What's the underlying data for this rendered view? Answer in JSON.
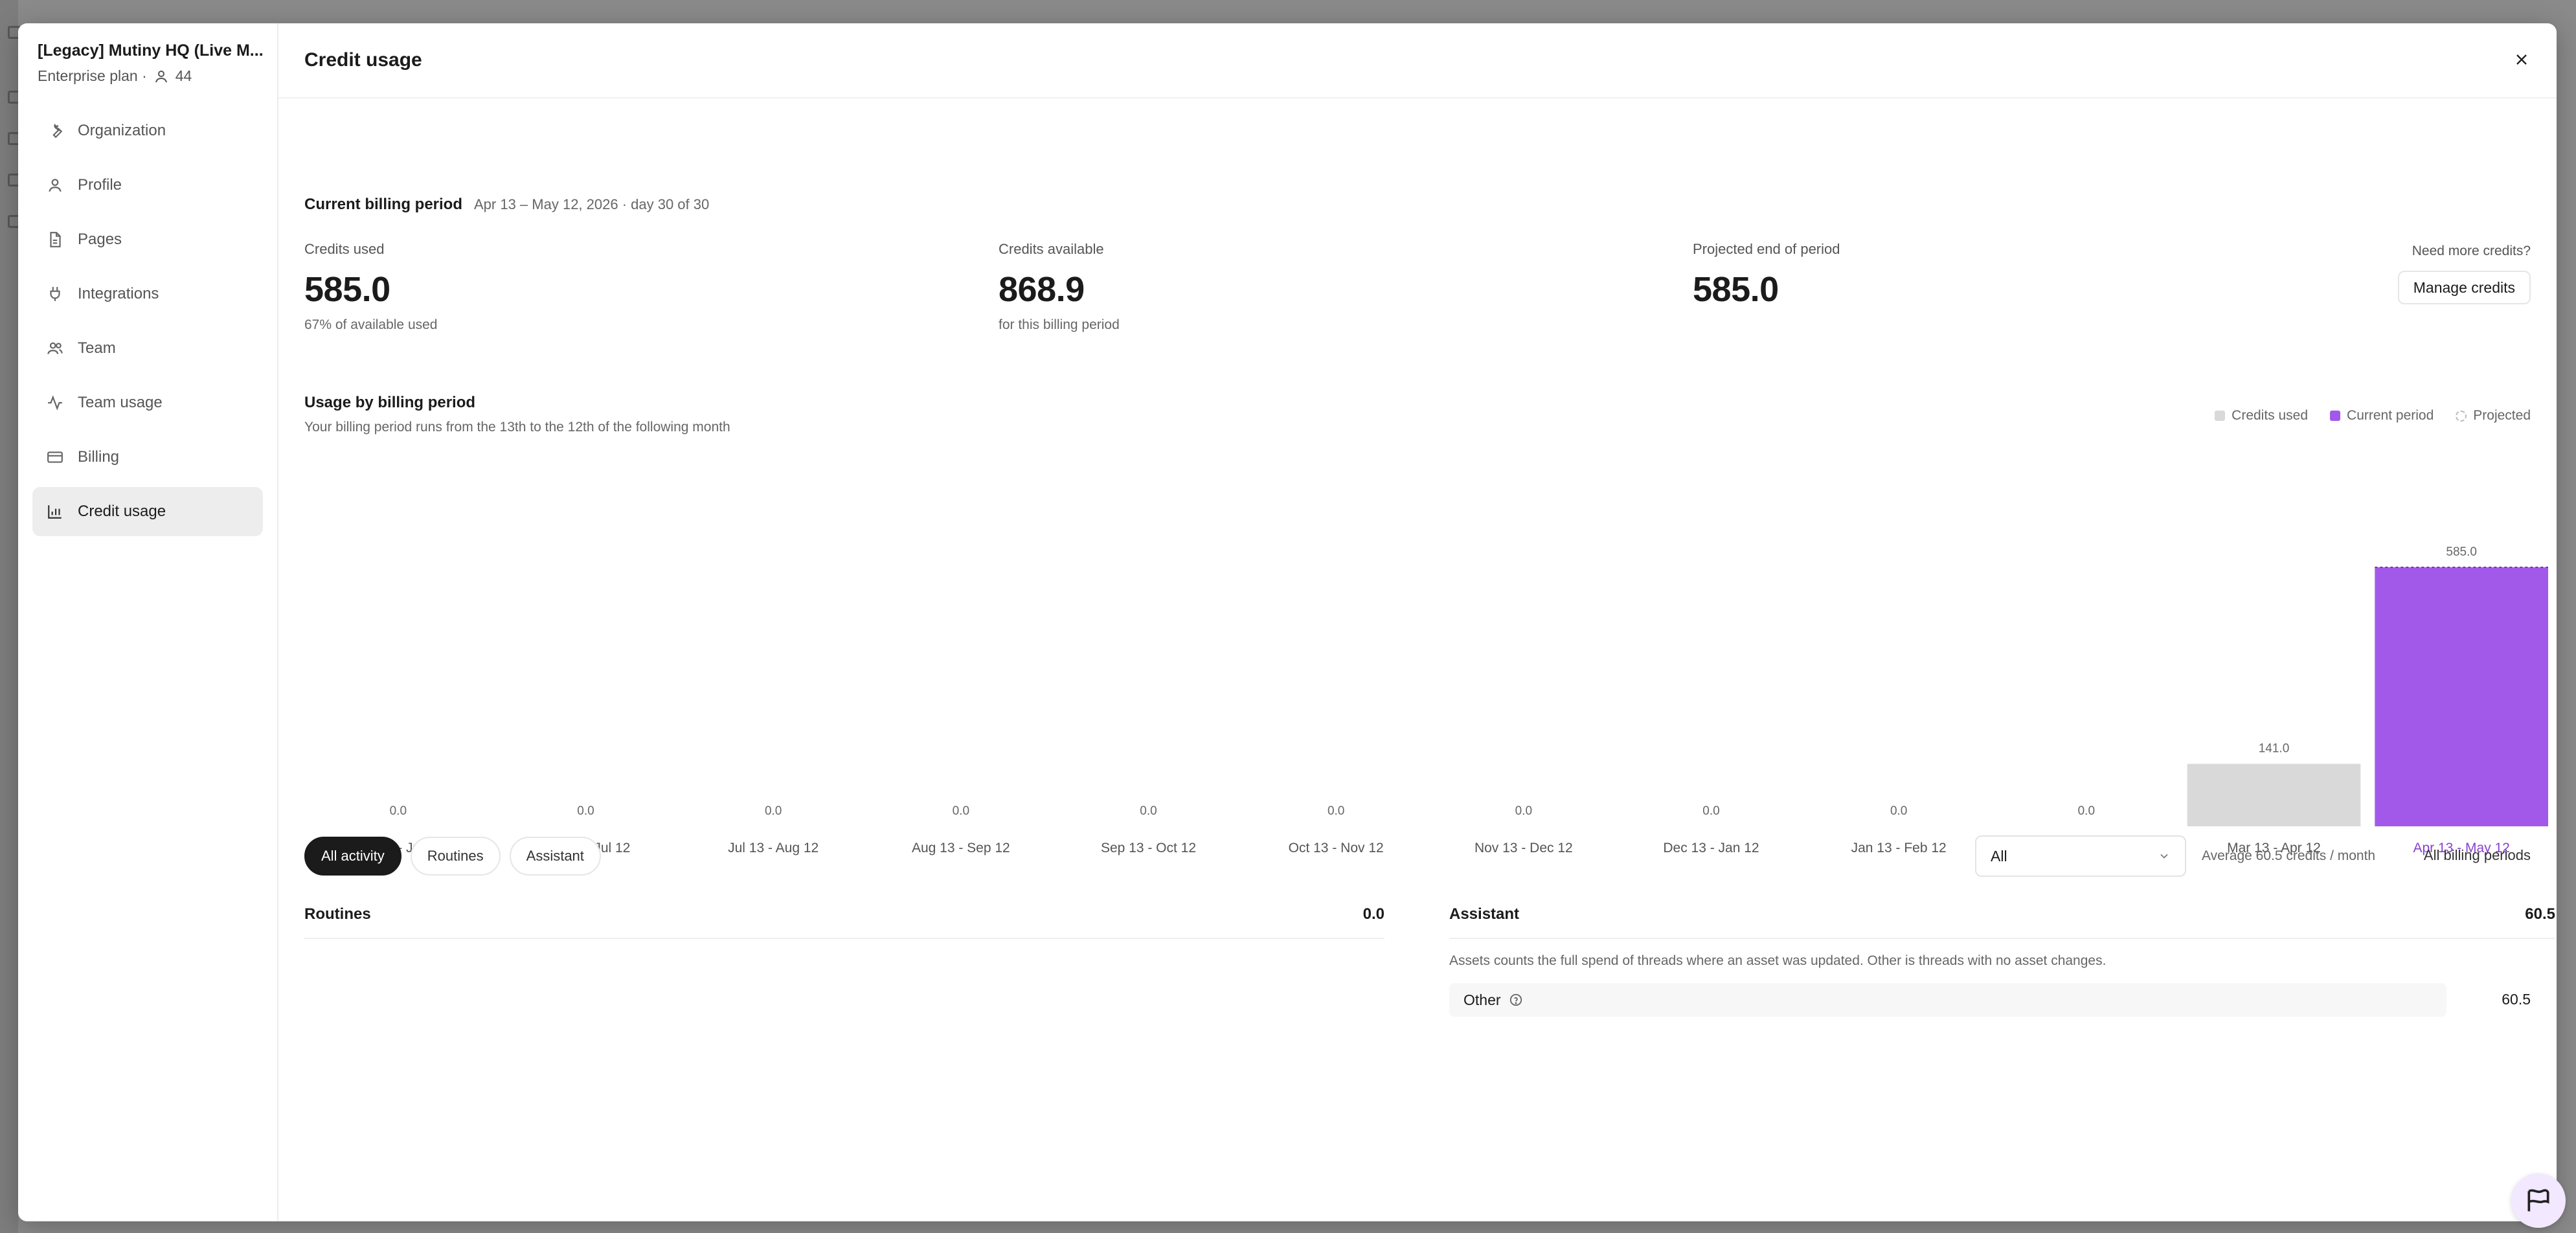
{
  "modal": {
    "org_name": "[Legacy] Mutiny HQ (Live M...",
    "plan": "Enterprise plan ·",
    "member_count": "44",
    "title": "Credit usage"
  },
  "sidebar": {
    "items": [
      {
        "label": "Organization",
        "icon": "wrench-icon"
      },
      {
        "label": "Profile",
        "icon": "user-icon"
      },
      {
        "label": "Pages",
        "icon": "document-icon"
      },
      {
        "label": "Integrations",
        "icon": "plug-icon"
      },
      {
        "label": "Team",
        "icon": "users-icon"
      },
      {
        "label": "Team usage",
        "icon": "activity-icon"
      },
      {
        "label": "Billing",
        "icon": "credit-card-icon"
      },
      {
        "label": "Credit usage",
        "icon": "bar-chart-icon",
        "active": true
      }
    ]
  },
  "billing": {
    "heading": "Current billing period",
    "range": "Apr 13 – May 12, 2026 · day 30 of 30",
    "credits_used": {
      "label": "Credits used",
      "value": "585.0",
      "sub": "67% of available used"
    },
    "credits_available": {
      "label": "Credits available",
      "value": "868.9",
      "sub": "for this billing period"
    },
    "projected": {
      "label": "Projected end of period",
      "value": "585.0"
    },
    "need_more": "Need more credits?",
    "manage_button": "Manage credits"
  },
  "usage": {
    "title": "Usage by billing period",
    "subtitle": "Your billing period runs from the 13th to the 12th of the following month",
    "legend": {
      "used": "Credits used",
      "current": "Current period",
      "projected": "Projected"
    }
  },
  "chart_data": {
    "type": "bar",
    "title": "Usage by billing period",
    "categories": [
      "May 13 - Jun 12",
      "Jun 13 - Jul 12",
      "Jul 13 - Aug 12",
      "Aug 13 - Sep 12",
      "Sep 13 - Oct 12",
      "Oct 13 - Nov 12",
      "Nov 13 - Dec 12",
      "Dec 13 - Jan 12",
      "Jan 13 - Feb 12",
      "Feb 13 - Mar 12",
      "Mar 13 - Apr 12",
      "Apr 13 - May 12"
    ],
    "values": [
      0.0,
      0.0,
      0.0,
      0.0,
      0.0,
      0.0,
      0.0,
      0.0,
      0.0,
      0.0,
      141.0,
      585.0
    ],
    "value_labels": [
      "0.0",
      "0.0",
      "0.0",
      "0.0",
      "0.0",
      "0.0",
      "0.0",
      "0.0",
      "0.0",
      "0.0",
      "141.0",
      "585.0"
    ],
    "current_period_index": 11,
    "colors": {
      "used": "#d9d9d9",
      "current": "#a259ea",
      "label": "#666666",
      "current_label": "#8a3fd1"
    }
  },
  "activity": {
    "tabs": [
      "All activity",
      "Routines",
      "Assistant"
    ],
    "active_tab": 0,
    "filter_value": "All",
    "average": "Average 60.5 credits / month",
    "all_periods": "All billing periods",
    "routines": {
      "title": "Routines",
      "total": "0.0"
    },
    "assistant": {
      "title": "Assistant",
      "total": "60.5",
      "note": "Assets counts the full spend of threads where an asset was updated. Other is threads with no asset changes.",
      "rows": [
        {
          "label": "Other",
          "value": "60.5"
        }
      ]
    }
  }
}
